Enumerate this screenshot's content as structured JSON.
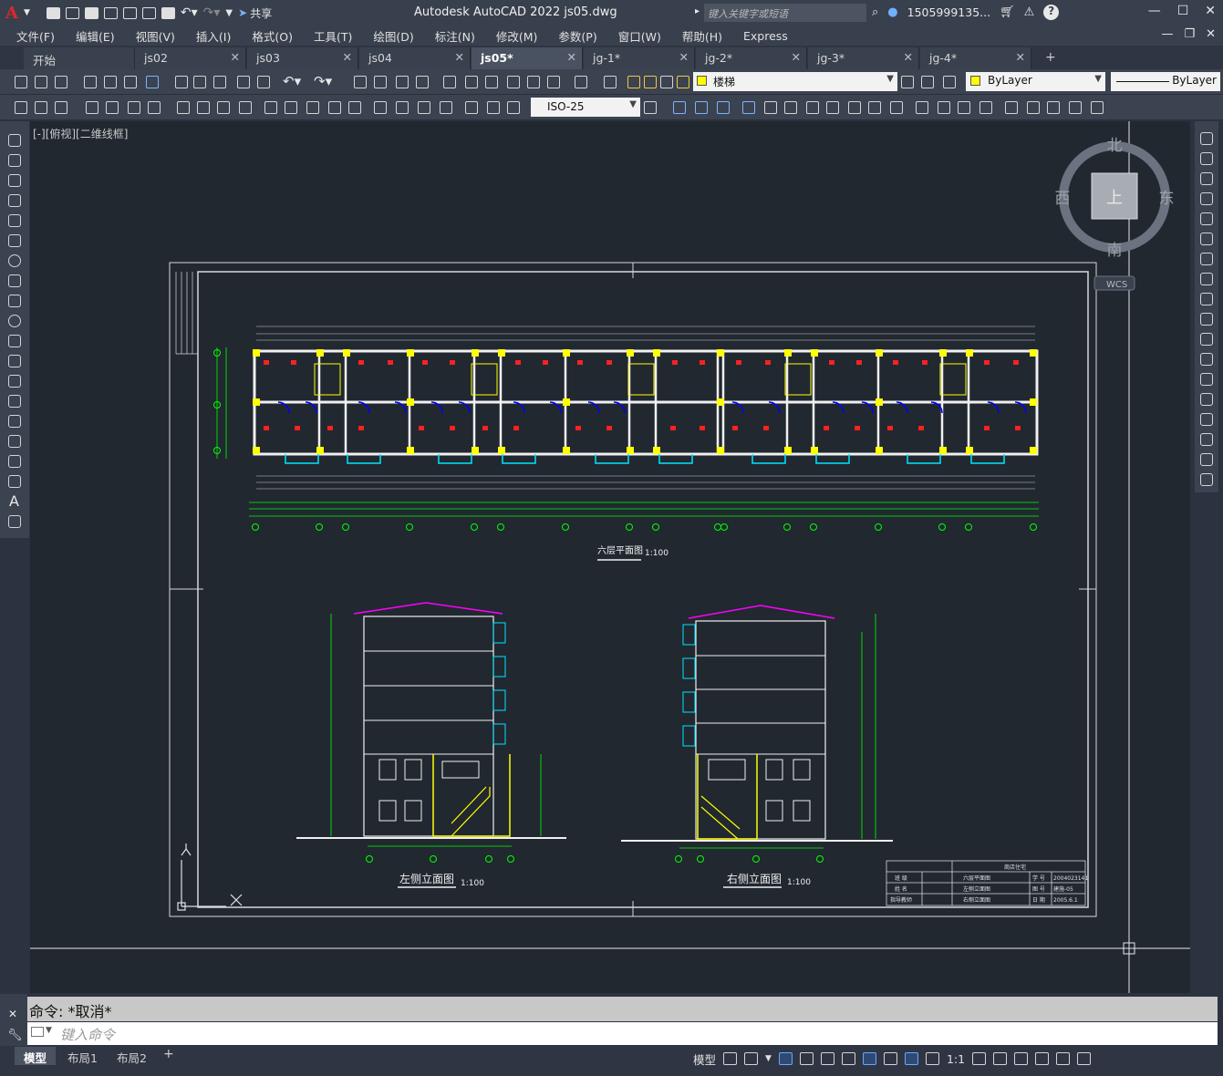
{
  "app": {
    "logo": "A",
    "share_label": "共享",
    "title": "Autodesk AutoCAD 2022    js05.dwg",
    "search_placeholder": "键入关键字或短语",
    "user": "1505999135...",
    "help": "?"
  },
  "menu": [
    "文件(F)",
    "编辑(E)",
    "视图(V)",
    "插入(I)",
    "格式(O)",
    "工具(T)",
    "绘图(D)",
    "标注(N)",
    "修改(M)",
    "参数(P)",
    "窗口(W)",
    "帮助(H)",
    "Express"
  ],
  "tabs": [
    {
      "label": "开始",
      "closable": false
    },
    {
      "label": "js02",
      "closable": true
    },
    {
      "label": "js03",
      "closable": true
    },
    {
      "label": "js04",
      "closable": true
    },
    {
      "label": "js05*",
      "closable": true,
      "active": true
    },
    {
      "label": "jg-1*",
      "closable": true
    },
    {
      "label": "jg-2*",
      "closable": true
    },
    {
      "label": "jg-3*",
      "closable": true
    },
    {
      "label": "jg-4*",
      "closable": true
    }
  ],
  "toolbar": {
    "layer_name": "楼梯",
    "color_value": "ByLayer",
    "linetype_value": "ByLayer",
    "dimstyle_value": "ISO-25",
    "layer_color": "#ffff00"
  },
  "viewport": {
    "label": "[-][俯视][二维线框]",
    "viewcube": {
      "north": "北",
      "south": "南",
      "east": "东",
      "west": "西",
      "face": "上"
    },
    "wcs": "WCS",
    "ucs_x": "X",
    "ucs_y": "Y"
  },
  "drawing": {
    "plan_title": "六层平面图",
    "plan_scale": "1:100",
    "left_title": "左侧立面图",
    "left_scale": "1:100",
    "right_title": "右侧立面图",
    "right_scale": "1:100",
    "title_block": {
      "project": "商店住宅",
      "rows": [
        {
          "label": "班 级",
          "sheet": "六层平面图",
          "k": "学 号",
          "v": "2004023141"
        },
        {
          "label": "姓 名",
          "sheet": "左侧立面图",
          "k": "图 号",
          "v": "建施-05"
        },
        {
          "label": "指导教师",
          "sheet": "右侧立面图",
          "k": "日 期",
          "v": "2005.6.1"
        }
      ]
    }
  },
  "command": {
    "history": "命令: *取消*",
    "placeholder": "键入命令"
  },
  "layout_tabs": [
    {
      "label": "模型",
      "active": true
    },
    {
      "label": "布局1"
    },
    {
      "label": "布局2"
    }
  ],
  "status": {
    "model": "模型",
    "scale": "1:1"
  }
}
